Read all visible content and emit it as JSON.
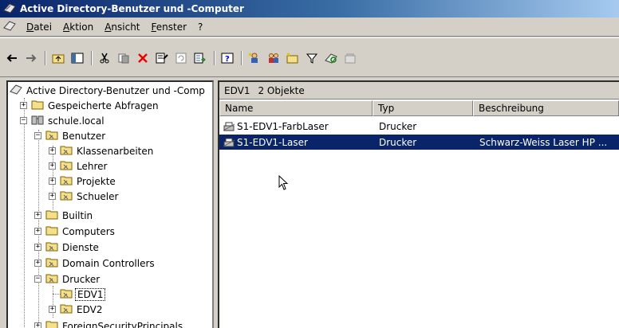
{
  "window": {
    "title": "Active Directory-Benutzer und -Computer"
  },
  "menu": [
    {
      "label": "Datei"
    },
    {
      "label": "Aktion"
    },
    {
      "label": "Ansicht"
    },
    {
      "label": "Fenster"
    },
    {
      "label": "?"
    }
  ],
  "toolbar": {
    "buttons": [
      "back-arrow-icon",
      "forward-arrow-icon",
      "up-folder-icon",
      "show-tree-icon",
      "cut-icon",
      "copy-icon",
      "delete-icon",
      "properties-icon",
      "refresh-icon",
      "export-icon",
      "help-icon",
      "new-user-icon",
      "new-group-icon",
      "new-ou-icon",
      "filter-icon",
      "find-icon",
      "delegate-icon"
    ]
  },
  "tree": {
    "root_label": "Active Directory-Benutzer und -Comp",
    "nodes": [
      {
        "label": "Gespeicherte Abfragen"
      },
      {
        "label": "schule.local"
      },
      {
        "label": "Benutzer"
      },
      {
        "label": "Klassenarbeiten"
      },
      {
        "label": "Lehrer"
      },
      {
        "label": "Projekte"
      },
      {
        "label": "Schueler"
      },
      {
        "label": "Builtin"
      },
      {
        "label": "Computers"
      },
      {
        "label": "Dienste"
      },
      {
        "label": "Domain Controllers"
      },
      {
        "label": "Drucker"
      },
      {
        "label": "EDV1"
      },
      {
        "label": "EDV2"
      },
      {
        "label": "ForeignSecurityPrincipals"
      }
    ]
  },
  "list": {
    "container": "EDV1",
    "count_text": "2 Objekte",
    "columns": [
      "Name",
      "Typ",
      "Beschreibung"
    ],
    "rows": [
      {
        "name": "S1-EDV1-FarbLaser",
        "type": "Drucker",
        "description": ""
      },
      {
        "name": "S1-EDV1-Laser",
        "type": "Drucker",
        "description": "Schwarz-Weiss Laser HP ..."
      }
    ]
  },
  "colors": {
    "title_start": "#0a246a",
    "title_end": "#a6caf0",
    "selection": "#0a246a",
    "chrome": "#d4d0c8"
  }
}
